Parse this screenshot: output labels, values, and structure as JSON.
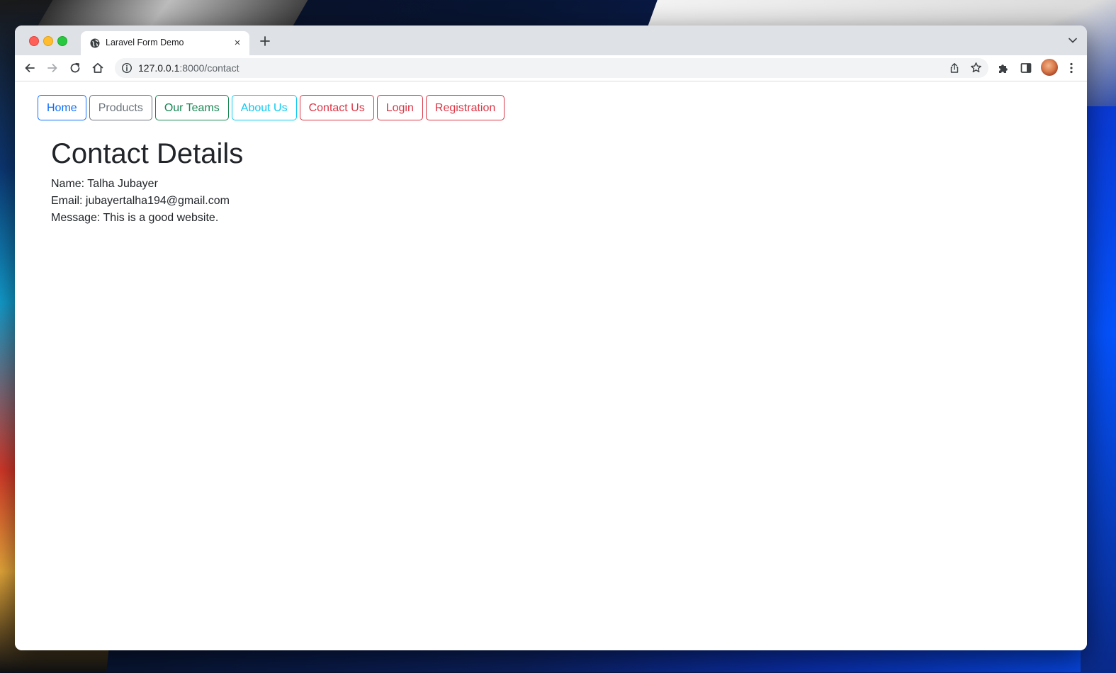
{
  "browser": {
    "tab_title": "Laravel Form Demo",
    "tab_close": "×",
    "url_host": "127.0.0.1",
    "url_rest": ":8000/contact",
    "icons": {
      "favicon": "globe-icon",
      "new_tab": "plus-icon",
      "tab_list": "chevron-down-icon",
      "back": "arrow-left-icon",
      "forward": "arrow-right-icon",
      "reload": "reload-icon",
      "home": "home-icon",
      "site_info": "info-icon",
      "share": "share-icon",
      "bookmark": "star-icon",
      "extensions": "puzzle-icon",
      "side_panel": "side-panel-icon",
      "profile": "avatar",
      "menu": "kebab-menu-icon"
    }
  },
  "nav": {
    "items": [
      {
        "label": "Home",
        "color": "#0d6efd"
      },
      {
        "label": "Products",
        "color": "#6c757d"
      },
      {
        "label": "Our Teams",
        "color": "#198754"
      },
      {
        "label": "About Us",
        "color": "#0dcaf0"
      },
      {
        "label": "Contact Us",
        "color": "#dc3545"
      },
      {
        "label": "Login",
        "color": "#dc3545"
      },
      {
        "label": "Registration",
        "color": "#dc3545"
      }
    ]
  },
  "page": {
    "heading": "Contact Details",
    "name_line": "Name: Talha Jubayer",
    "email_line": "Email: jubayertalha194@gmail.com",
    "message_line": "Message: This is a good website."
  }
}
